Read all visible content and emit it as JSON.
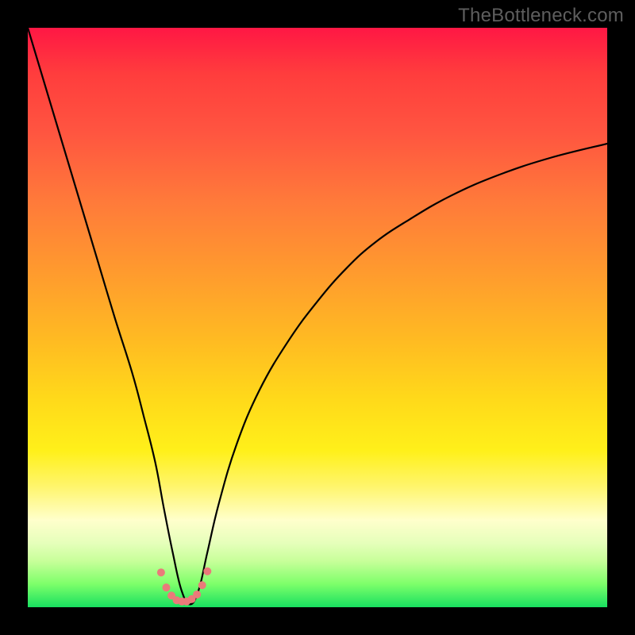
{
  "watermark": "TheBottleneck.com",
  "chart_data": {
    "type": "line",
    "title": "",
    "xlabel": "",
    "ylabel": "",
    "xlim": [
      0,
      100
    ],
    "ylim": [
      0,
      100
    ],
    "grid": false,
    "legend": false,
    "series": [
      {
        "name": "bottleneck-curve",
        "color": "#000000",
        "x": [
          0,
          3,
          6,
          9,
          12,
          15,
          18,
          20,
          22,
          23.5,
          25,
          26.5,
          28,
          29.5,
          31,
          33,
          36,
          40,
          45,
          50,
          55,
          60,
          66,
          73,
          81,
          90,
          100
        ],
        "y": [
          100,
          90,
          80,
          70,
          60,
          50,
          40.5,
          33,
          25,
          17,
          9.5,
          3,
          0.5,
          3,
          9.5,
          18,
          28,
          37.5,
          46,
          52.8,
          58.5,
          63,
          67,
          71,
          74.5,
          77.5,
          80
        ]
      },
      {
        "name": "trough-markers",
        "type": "scatter",
        "color": "#ea7a7a",
        "marker_shape": "circle",
        "marker_size": 10,
        "x": [
          23.0,
          23.9,
          24.8,
          25.7,
          26.6,
          27.4,
          28.3,
          29.2,
          30.1,
          31.0
        ],
        "y": [
          6.0,
          3.4,
          2.0,
          1.2,
          1.0,
          1.0,
          1.4,
          2.2,
          3.8,
          6.2
        ]
      }
    ],
    "background_gradient": {
      "type": "vertical",
      "stops": [
        {
          "pos": 0.0,
          "color": "#ff1744"
        },
        {
          "pos": 0.18,
          "color": "#ff5540"
        },
        {
          "pos": 0.42,
          "color": "#ff9a2e"
        },
        {
          "pos": 0.64,
          "color": "#ffd91a"
        },
        {
          "pos": 0.85,
          "color": "#ffffcc"
        },
        {
          "pos": 0.96,
          "color": "#7dff6a"
        },
        {
          "pos": 1.0,
          "color": "#18e060"
        }
      ]
    }
  }
}
